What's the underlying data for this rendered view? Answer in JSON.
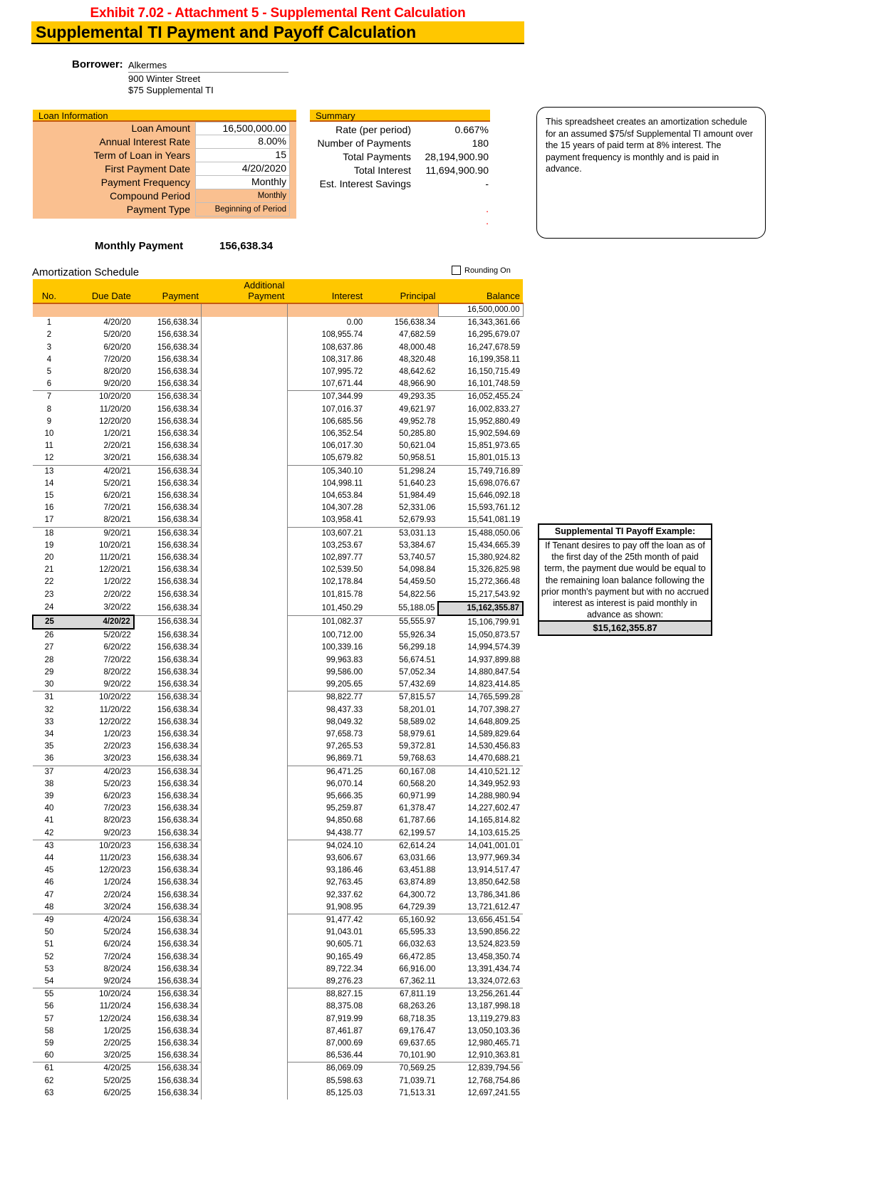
{
  "header": {
    "exhibit_title": "Exhibit 7.02 - Attachment 5 - Supplemental Rent Calculation",
    "main_title": "Supplemental TI Payment and Payoff Calculation"
  },
  "borrower": {
    "label": "Borrower:",
    "name": "Alkermes",
    "address": "900 Winter Street",
    "note": "$75 Supplemental TI"
  },
  "loan_information": {
    "panel_title": "Loan Information",
    "rows": [
      {
        "label": "Loan Amount",
        "value": "16,500,000.00",
        "shaded": false
      },
      {
        "label": "Annual Interest Rate",
        "value": "8.00%",
        "shaded": false
      },
      {
        "label": "Term of Loan in Years",
        "value": "15",
        "shaded": false
      },
      {
        "label": "First Payment Date",
        "value": "4/20/2020",
        "shaded": false
      },
      {
        "label": "Payment Frequency",
        "value": "Monthly",
        "shaded": false
      },
      {
        "label": "Compound Period",
        "value": "Monthly",
        "shaded": true
      },
      {
        "label": "Payment Type",
        "value": "Beginning of Period",
        "shaded": true
      }
    ]
  },
  "summary": {
    "panel_title": "Summary",
    "rows": [
      {
        "label": "Rate (per period)",
        "value": "0.667%"
      },
      {
        "label": "Number of Payments",
        "value": "180"
      },
      {
        "label": "Total Payments",
        "value": "28,194,900.90"
      },
      {
        "label": "Total Interest",
        "value": "11,694,900.90"
      },
      {
        "label": "Est. Interest Savings",
        "value": "-"
      }
    ]
  },
  "info_callout": {
    "text": "This spreadsheet creates an amortization schedule for an assumed $75/sf Supplemental TI amount over the 15 years of paid term at 8% interest.  The payment frequency is monthly and is paid in advance."
  },
  "monthly_payment": {
    "label": "Monthly Payment",
    "value": "156,638.34"
  },
  "amortization": {
    "section_label": "Amortization Schedule",
    "rounding_label": "Rounding On",
    "columns": [
      "No.",
      "Due Date",
      "Payment",
      "Additional Payment",
      "Interest",
      "Principal",
      "Balance"
    ],
    "column_additional_line1": "Additional",
    "column_additional_line2": "Payment",
    "opening_balance": "16,500,000.00",
    "rows": [
      {
        "no": "1",
        "date": "4/20/20",
        "payment": "156,638.34",
        "interest": "0.00",
        "principal": "156,638.34",
        "balance": "16,343,361.66"
      },
      {
        "no": "2",
        "date": "5/20/20",
        "payment": "156,638.34",
        "interest": "108,955.74",
        "principal": "47,682.59",
        "balance": "16,295,679.07"
      },
      {
        "no": "3",
        "date": "6/20/20",
        "payment": "156,638.34",
        "interest": "108,637.86",
        "principal": "48,000.48",
        "balance": "16,247,678.59"
      },
      {
        "no": "4",
        "date": "7/20/20",
        "payment": "156,638.34",
        "interest": "108,317.86",
        "principal": "48,320.48",
        "balance": "16,199,358.11"
      },
      {
        "no": "5",
        "date": "8/20/20",
        "payment": "156,638.34",
        "interest": "107,995.72",
        "principal": "48,642.62",
        "balance": "16,150,715.49"
      },
      {
        "no": "6",
        "date": "9/20/20",
        "payment": "156,638.34",
        "interest": "107,671.44",
        "principal": "48,966.90",
        "balance": "16,101,748.59"
      },
      {
        "no": "7",
        "date": "10/20/20",
        "payment": "156,638.34",
        "interest": "107,344.99",
        "principal": "49,293.35",
        "balance": "16,052,455.24"
      },
      {
        "no": "8",
        "date": "11/20/20",
        "payment": "156,638.34",
        "interest": "107,016.37",
        "principal": "49,621.97",
        "balance": "16,002,833.27"
      },
      {
        "no": "9",
        "date": "12/20/20",
        "payment": "156,638.34",
        "interest": "106,685.56",
        "principal": "49,952.78",
        "balance": "15,952,880.49"
      },
      {
        "no": "10",
        "date": "1/20/21",
        "payment": "156,638.34",
        "interest": "106,352.54",
        "principal": "50,285.80",
        "balance": "15,902,594.69"
      },
      {
        "no": "11",
        "date": "2/20/21",
        "payment": "156,638.34",
        "interest": "106,017.30",
        "principal": "50,621.04",
        "balance": "15,851,973.65"
      },
      {
        "no": "12",
        "date": "3/20/21",
        "payment": "156,638.34",
        "interest": "105,679.82",
        "principal": "50,958.51",
        "balance": "15,801,015.13"
      },
      {
        "no": "13",
        "date": "4/20/21",
        "payment": "156,638.34",
        "interest": "105,340.10",
        "principal": "51,298.24",
        "balance": "15,749,716.89"
      },
      {
        "no": "14",
        "date": "5/20/21",
        "payment": "156,638.34",
        "interest": "104,998.11",
        "principal": "51,640.23",
        "balance": "15,698,076.67"
      },
      {
        "no": "15",
        "date": "6/20/21",
        "payment": "156,638.34",
        "interest": "104,653.84",
        "principal": "51,984.49",
        "balance": "15,646,092.18"
      },
      {
        "no": "16",
        "date": "7/20/21",
        "payment": "156,638.34",
        "interest": "104,307.28",
        "principal": "52,331.06",
        "balance": "15,593,761.12"
      },
      {
        "no": "17",
        "date": "8/20/21",
        "payment": "156,638.34",
        "interest": "103,958.41",
        "principal": "52,679.93",
        "balance": "15,541,081.19"
      },
      {
        "no": "18",
        "date": "9/20/21",
        "payment": "156,638.34",
        "interest": "103,607.21",
        "principal": "53,031.13",
        "balance": "15,488,050.06"
      },
      {
        "no": "19",
        "date": "10/20/21",
        "payment": "156,638.34",
        "interest": "103,253.67",
        "principal": "53,384.67",
        "balance": "15,434,665.39"
      },
      {
        "no": "20",
        "date": "11/20/21",
        "payment": "156,638.34",
        "interest": "102,897.77",
        "principal": "53,740.57",
        "balance": "15,380,924.82"
      },
      {
        "no": "21",
        "date": "12/20/21",
        "payment": "156,638.34",
        "interest": "102,539.50",
        "principal": "54,098.84",
        "balance": "15,326,825.98"
      },
      {
        "no": "22",
        "date": "1/20/22",
        "payment": "156,638.34",
        "interest": "102,178.84",
        "principal": "54,459.50",
        "balance": "15,272,366.48"
      },
      {
        "no": "23",
        "date": "2/20/22",
        "payment": "156,638.34",
        "interest": "101,815.78",
        "principal": "54,822.56",
        "balance": "15,217,543.92"
      },
      {
        "no": "24",
        "date": "3/20/22",
        "payment": "156,638.34",
        "interest": "101,450.29",
        "principal": "55,188.05",
        "balance": "15,162,355.87",
        "balance_highlight": true
      },
      {
        "no": "25",
        "date": "4/20/22",
        "payment": "156,638.34",
        "interest": "101,082.37",
        "principal": "55,555.97",
        "balance": "15,106,799.91",
        "row_highlight": true
      },
      {
        "no": "26",
        "date": "5/20/22",
        "payment": "156,638.34",
        "interest": "100,712.00",
        "principal": "55,926.34",
        "balance": "15,050,873.57"
      },
      {
        "no": "27",
        "date": "6/20/22",
        "payment": "156,638.34",
        "interest": "100,339.16",
        "principal": "56,299.18",
        "balance": "14,994,574.39"
      },
      {
        "no": "28",
        "date": "7/20/22",
        "payment": "156,638.34",
        "interest": "99,963.83",
        "principal": "56,674.51",
        "balance": "14,937,899.88"
      },
      {
        "no": "29",
        "date": "8/20/22",
        "payment": "156,638.34",
        "interest": "99,586.00",
        "principal": "57,052.34",
        "balance": "14,880,847.54"
      },
      {
        "no": "30",
        "date": "9/20/22",
        "payment": "156,638.34",
        "interest": "99,205.65",
        "principal": "57,432.69",
        "balance": "14,823,414.85"
      },
      {
        "no": "31",
        "date": "10/20/22",
        "payment": "156,638.34",
        "interest": "98,822.77",
        "principal": "57,815.57",
        "balance": "14,765,599.28"
      },
      {
        "no": "32",
        "date": "11/20/22",
        "payment": "156,638.34",
        "interest": "98,437.33",
        "principal": "58,201.01",
        "balance": "14,707,398.27"
      },
      {
        "no": "33",
        "date": "12/20/22",
        "payment": "156,638.34",
        "interest": "98,049.32",
        "principal": "58,589.02",
        "balance": "14,648,809.25"
      },
      {
        "no": "34",
        "date": "1/20/23",
        "payment": "156,638.34",
        "interest": "97,658.73",
        "principal": "58,979.61",
        "balance": "14,589,829.64"
      },
      {
        "no": "35",
        "date": "2/20/23",
        "payment": "156,638.34",
        "interest": "97,265.53",
        "principal": "59,372.81",
        "balance": "14,530,456.83"
      },
      {
        "no": "36",
        "date": "3/20/23",
        "payment": "156,638.34",
        "interest": "96,869.71",
        "principal": "59,768.63",
        "balance": "14,470,688.21"
      },
      {
        "no": "37",
        "date": "4/20/23",
        "payment": "156,638.34",
        "interest": "96,471.25",
        "principal": "60,167.08",
        "balance": "14,410,521.12"
      },
      {
        "no": "38",
        "date": "5/20/23",
        "payment": "156,638.34",
        "interest": "96,070.14",
        "principal": "60,568.20",
        "balance": "14,349,952.93"
      },
      {
        "no": "39",
        "date": "6/20/23",
        "payment": "156,638.34",
        "interest": "95,666.35",
        "principal": "60,971.99",
        "balance": "14,288,980.94"
      },
      {
        "no": "40",
        "date": "7/20/23",
        "payment": "156,638.34",
        "interest": "95,259.87",
        "principal": "61,378.47",
        "balance": "14,227,602.47"
      },
      {
        "no": "41",
        "date": "8/20/23",
        "payment": "156,638.34",
        "interest": "94,850.68",
        "principal": "61,787.66",
        "balance": "14,165,814.82"
      },
      {
        "no": "42",
        "date": "9/20/23",
        "payment": "156,638.34",
        "interest": "94,438.77",
        "principal": "62,199.57",
        "balance": "14,103,615.25"
      },
      {
        "no": "43",
        "date": "10/20/23",
        "payment": "156,638.34",
        "interest": "94,024.10",
        "principal": "62,614.24",
        "balance": "14,041,001.01"
      },
      {
        "no": "44",
        "date": "11/20/23",
        "payment": "156,638.34",
        "interest": "93,606.67",
        "principal": "63,031.66",
        "balance": "13,977,969.34"
      },
      {
        "no": "45",
        "date": "12/20/23",
        "payment": "156,638.34",
        "interest": "93,186.46",
        "principal": "63,451.88",
        "balance": "13,914,517.47"
      },
      {
        "no": "46",
        "date": "1/20/24",
        "payment": "156,638.34",
        "interest": "92,763.45",
        "principal": "63,874.89",
        "balance": "13,850,642.58"
      },
      {
        "no": "47",
        "date": "2/20/24",
        "payment": "156,638.34",
        "interest": "92,337.62",
        "principal": "64,300.72",
        "balance": "13,786,341.86"
      },
      {
        "no": "48",
        "date": "3/20/24",
        "payment": "156,638.34",
        "interest": "91,908.95",
        "principal": "64,729.39",
        "balance": "13,721,612.47"
      },
      {
        "no": "49",
        "date": "4/20/24",
        "payment": "156,638.34",
        "interest": "91,477.42",
        "principal": "65,160.92",
        "balance": "13,656,451.54"
      },
      {
        "no": "50",
        "date": "5/20/24",
        "payment": "156,638.34",
        "interest": "91,043.01",
        "principal": "65,595.33",
        "balance": "13,590,856.22"
      },
      {
        "no": "51",
        "date": "6/20/24",
        "payment": "156,638.34",
        "interest": "90,605.71",
        "principal": "66,032.63",
        "balance": "13,524,823.59"
      },
      {
        "no": "52",
        "date": "7/20/24",
        "payment": "156,638.34",
        "interest": "90,165.49",
        "principal": "66,472.85",
        "balance": "13,458,350.74"
      },
      {
        "no": "53",
        "date": "8/20/24",
        "payment": "156,638.34",
        "interest": "89,722.34",
        "principal": "66,916.00",
        "balance": "13,391,434.74"
      },
      {
        "no": "54",
        "date": "9/20/24",
        "payment": "156,638.34",
        "interest": "89,276.23",
        "principal": "67,362.11",
        "balance": "13,324,072.63"
      },
      {
        "no": "55",
        "date": "10/20/24",
        "payment": "156,638.34",
        "interest": "88,827.15",
        "principal": "67,811.19",
        "balance": "13,256,261.44"
      },
      {
        "no": "56",
        "date": "11/20/24",
        "payment": "156,638.34",
        "interest": "88,375.08",
        "principal": "68,263.26",
        "balance": "13,187,998.18"
      },
      {
        "no": "57",
        "date": "12/20/24",
        "payment": "156,638.34",
        "interest": "87,919.99",
        "principal": "68,718.35",
        "balance": "13,119,279.83"
      },
      {
        "no": "58",
        "date": "1/20/25",
        "payment": "156,638.34",
        "interest": "87,461.87",
        "principal": "69,176.47",
        "balance": "13,050,103.36"
      },
      {
        "no": "59",
        "date": "2/20/25",
        "payment": "156,638.34",
        "interest": "87,000.69",
        "principal": "69,637.65",
        "balance": "12,980,465.71"
      },
      {
        "no": "60",
        "date": "3/20/25",
        "payment": "156,638.34",
        "interest": "86,536.44",
        "principal": "70,101.90",
        "balance": "12,910,363.81"
      },
      {
        "no": "61",
        "date": "4/20/25",
        "payment": "156,638.34",
        "interest": "86,069.09",
        "principal": "70,569.25",
        "balance": "12,839,794.56"
      },
      {
        "no": "62",
        "date": "5/20/25",
        "payment": "156,638.34",
        "interest": "85,598.63",
        "principal": "71,039.71",
        "balance": "12,768,754.86"
      },
      {
        "no": "63",
        "date": "6/20/25",
        "payment": "156,638.34",
        "interest": "85,125.03",
        "principal": "71,513.31",
        "balance": "12,697,241.55"
      }
    ]
  },
  "payoff_example": {
    "title": "Supplemental TI Payoff Example:",
    "text": "If Tenant desires to pay off the loan as of the first day of the 25th month of paid term, the payment due would be equal to the remaining loan balance following the prior month's payment but with no accrued interest as interest is paid monthly in advance as shown:",
    "amount": "$15,162,355.87"
  },
  "colors": {
    "header_yellow": "#ffc700",
    "panel_fill": "#fac090",
    "accent_rule": "#c55a11",
    "title_red": "#ff0000",
    "highlight_gray": "#d9d9d9"
  }
}
